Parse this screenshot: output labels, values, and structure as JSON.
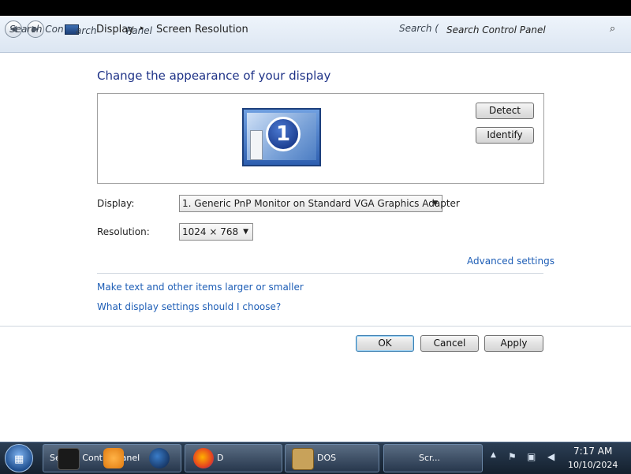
{
  "address_bar": {
    "ghost_search_left": "Search Con",
    "ghost_search_left_2": "arch",
    "breadcrumb_display": "Display",
    "ghost_panel": "Panel",
    "breadcrumb_sep": "▸",
    "breadcrumb_current": "Screen Resolution",
    "ghost_search_mid": "Search (",
    "search_placeholder": "Search Control Panel",
    "search_glyph": "⌕"
  },
  "main": {
    "heading": "Change the appearance of your display",
    "detect_label": "Detect",
    "identify_label": "Identify",
    "monitor_number": "1",
    "display_label": "Display:",
    "display_value": "1. Generic PnP Monitor on Standard VGA Graphics Adapter",
    "resolution_label": "Resolution:",
    "resolution_value": "1024 × 768",
    "advanced_link": "Advanced settings",
    "text_size_link": "Make text and other items larger or smaller",
    "help_link": "What display settings should I choose?",
    "ok_label": "OK",
    "cancel_label": "Cancel",
    "apply_label": "Apply"
  },
  "taskbar": {
    "item1_label": "Search Control Panel",
    "item2_label": "D",
    "item3_label": "DOS",
    "item4_label": "Scr...",
    "clock_time": "7:17 AM",
    "clock_date": "10/10/2024"
  },
  "icons": [
    "back-icon",
    "forward-icon",
    "display-icon",
    "search-icon",
    "monitor-icon",
    "dropdown-arrow-icon",
    "windows-start-icon",
    "media-player-icon",
    "firefox-icon",
    "dosbox-icon",
    "flag-icon",
    "network-icon",
    "volume-icon"
  ],
  "colors": {
    "heading": "#1e3287",
    "link": "#1e5eb6",
    "taskbar": "#14202e"
  }
}
